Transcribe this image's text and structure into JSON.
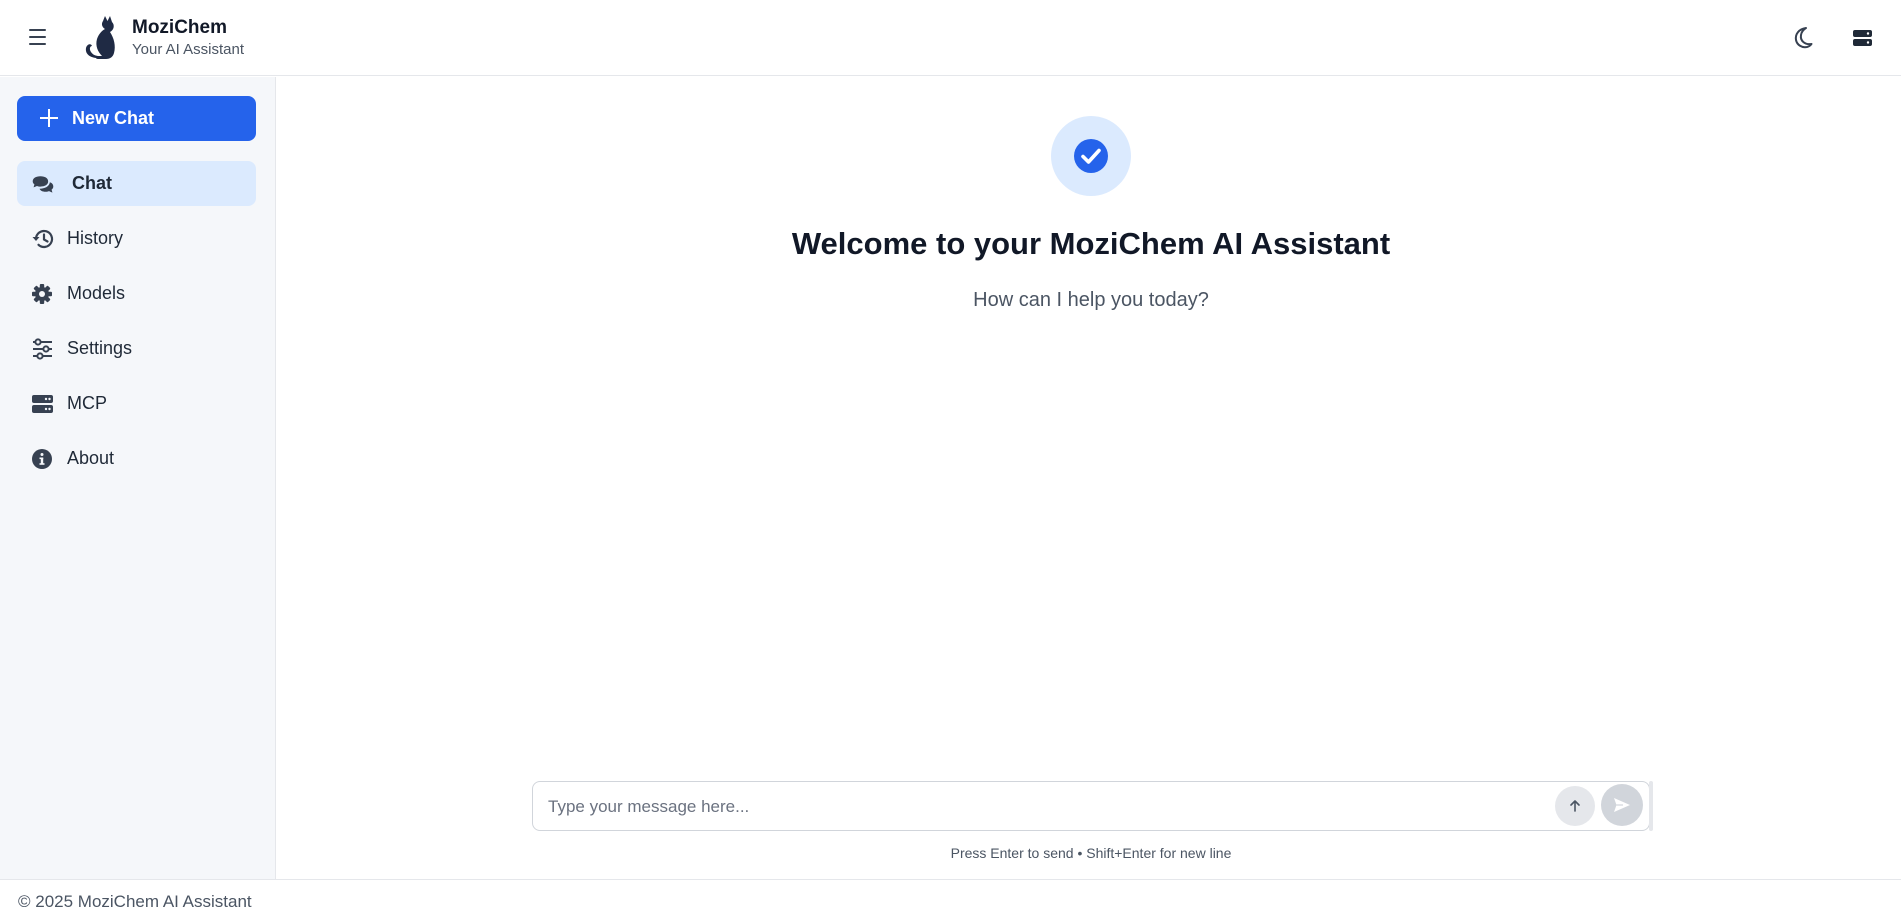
{
  "header": {
    "brand_name": "MoziChem",
    "brand_subtitle": "Your AI Assistant",
    "icons": {
      "menu": "hamburger-menu-icon",
      "logo": "cat-logo-icon",
      "theme": "moon-icon",
      "server": "server-icon"
    }
  },
  "sidebar": {
    "new_chat_label": "New Chat",
    "items": [
      {
        "label": "Chat",
        "icon": "comments-icon",
        "active": true
      },
      {
        "label": "History",
        "icon": "history-icon",
        "active": false
      },
      {
        "label": "Models",
        "icon": "gear-icon",
        "active": false
      },
      {
        "label": "Settings",
        "icon": "sliders-icon",
        "active": false
      },
      {
        "label": "MCP",
        "icon": "server-icon",
        "active": false
      },
      {
        "label": "About",
        "icon": "info-icon",
        "active": false
      }
    ]
  },
  "main": {
    "welcome_title": "Welcome to your MoziChem AI Assistant",
    "welcome_subtitle": "How can I help you today?",
    "input_placeholder": "Type your message here...",
    "input_value": "",
    "hint": "Press Enter to send • Shift+Enter for new line"
  },
  "footer": {
    "copyright": "© 2025 MoziChem AI Assistant"
  },
  "colors": {
    "accent": "#2563eb",
    "accent_light": "#dbeafe",
    "sidebar_bg": "#f5f7fa",
    "text_dark": "#111827",
    "text_muted": "#4b5563"
  }
}
